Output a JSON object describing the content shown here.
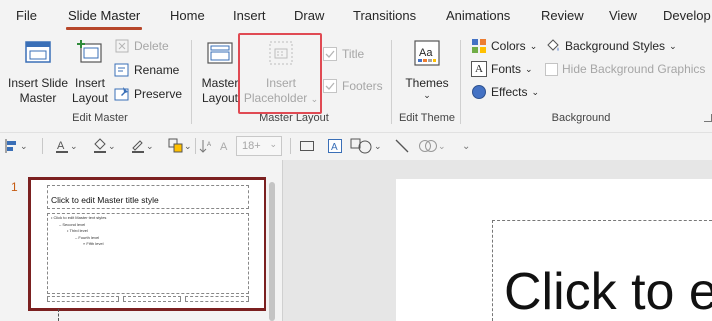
{
  "tabs": [
    {
      "label": "File"
    },
    {
      "label": "Slide Master"
    },
    {
      "label": "Home"
    },
    {
      "label": "Insert"
    },
    {
      "label": "Draw"
    },
    {
      "label": "Transitions"
    },
    {
      "label": "Animations"
    },
    {
      "label": "Review"
    },
    {
      "label": "View"
    },
    {
      "label": "Develop"
    }
  ],
  "ribbon": {
    "edit_master": {
      "label": "Edit Master",
      "insert_slide_master": [
        "Insert Slide",
        "Master"
      ],
      "insert_layout": [
        "Insert",
        "Layout"
      ],
      "delete": "Delete",
      "rename": "Rename",
      "preserve": "Preserve"
    },
    "master_layout": {
      "label": "Master Layout",
      "master_layout_btn": [
        "Master",
        "Layout"
      ],
      "insert_placeholder": [
        "Insert",
        "Placeholder"
      ],
      "title": "Title",
      "footers": "Footers"
    },
    "edit_theme": {
      "label": "Edit Theme",
      "themes": "Themes"
    },
    "background": {
      "label": "Background",
      "colors": "Colors",
      "fonts": "Fonts",
      "effects": "Effects",
      "background_styles": "Background Styles",
      "hide_background_graphics": "Hide Background Graphics"
    }
  },
  "toolbar": {
    "font_size": "18+"
  },
  "thumbnails": {
    "slide_number": "1",
    "title": "Click to edit Master title style",
    "bullets": [
      "• Click to edit Master text styles",
      "– Second level",
      "• Third level",
      "– Fourth level",
      "» Fifth level"
    ]
  },
  "canvas": {
    "title_text": "Click to e"
  },
  "colors": {
    "accent": "#b7472a",
    "highlight": "#e04a53",
    "slide_border": "#7b2020",
    "slide_number": "#c55a11"
  }
}
